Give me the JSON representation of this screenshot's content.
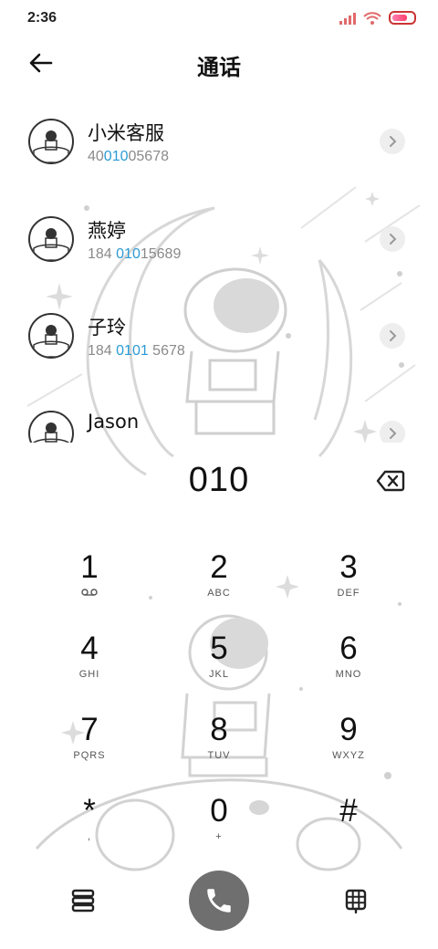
{
  "status_bar": {
    "time": "2:36"
  },
  "header": {
    "title": "通话"
  },
  "contacts": [
    {
      "name": "小米客服",
      "number_parts": [
        "40",
        "010",
        "05678"
      ]
    },
    {
      "name": "燕婷",
      "number_parts": [
        "184 ",
        "010",
        "15689"
      ]
    },
    {
      "name": "子玲",
      "number_parts": [
        "184 ",
        "0101",
        " 5678"
      ]
    },
    {
      "name": "Jason",
      "number_parts": [
        "",
        "",
        ""
      ]
    }
  ],
  "dialer": {
    "number": "010"
  },
  "keypad": [
    {
      "digit": "1",
      "letters": ""
    },
    {
      "digit": "2",
      "letters": "ABC"
    },
    {
      "digit": "3",
      "letters": "DEF"
    },
    {
      "digit": "4",
      "letters": "GHI"
    },
    {
      "digit": "5",
      "letters": "JKL"
    },
    {
      "digit": "6",
      "letters": "MNO"
    },
    {
      "digit": "7",
      "letters": "PQRS"
    },
    {
      "digit": "8",
      "letters": "TUV"
    },
    {
      "digit": "9",
      "letters": "WXYZ"
    },
    {
      "digit": "*",
      "letters": ","
    },
    {
      "digit": "0",
      "letters": "+"
    },
    {
      "digit": "#",
      "letters": ""
    }
  ],
  "icons": {
    "back": "back-arrow-icon",
    "backspace": "backspace-icon",
    "call": "phone-icon",
    "menu": "stacked-menu-icon",
    "keypad_toggle": "dialpad-grid-icon",
    "voicemail": "voicemail-icon"
  },
  "colors": {
    "highlight": "#2a9bd6",
    "call_button": "#6f6f6f"
  }
}
